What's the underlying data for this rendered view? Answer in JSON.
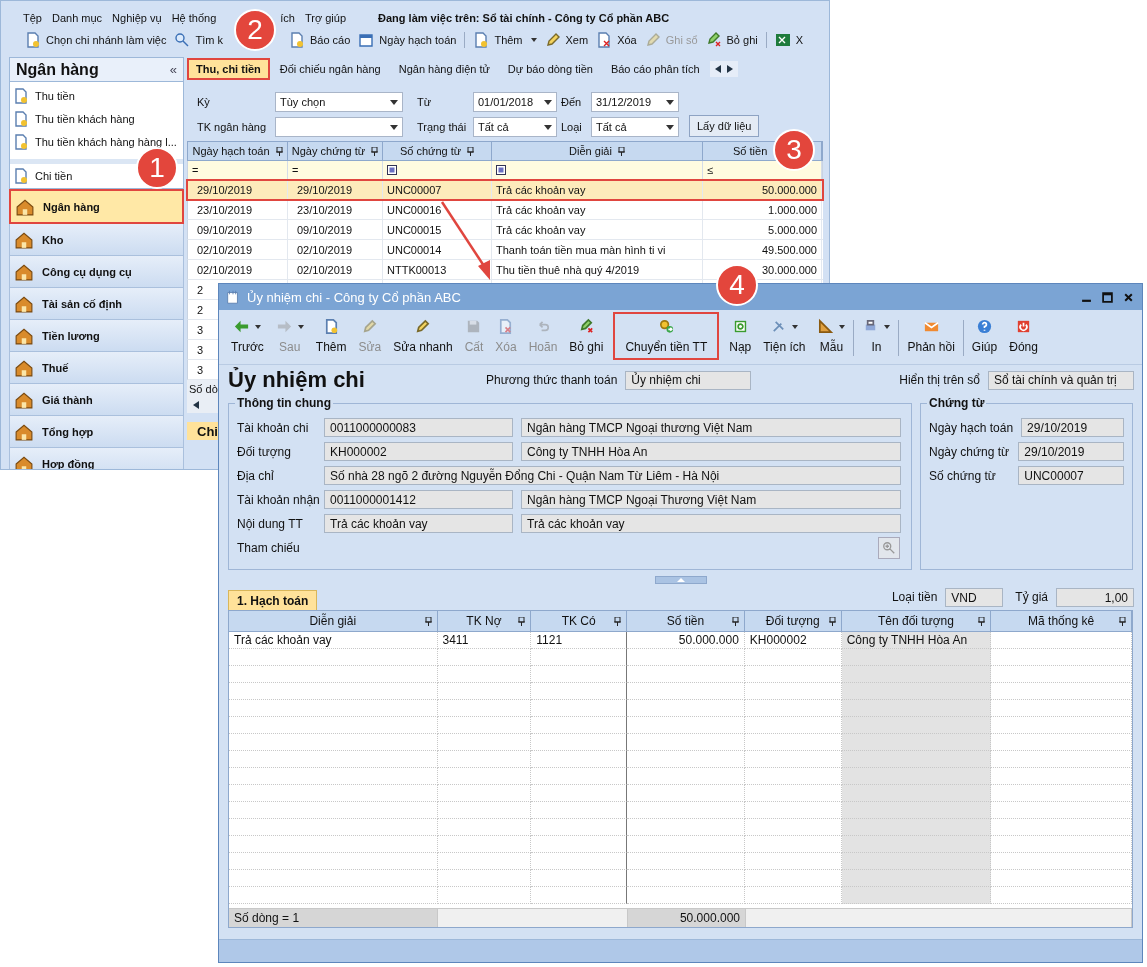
{
  "main_window": {
    "menu": [
      "Tệp",
      "Danh mục",
      "Nghiệp vụ",
      "Hệ thống",
      "ích",
      "Trợ giúp"
    ],
    "working_on": "Đang làm việc trên: Sổ tài chính - Công ty Cổ phần ABC",
    "toolbar": [
      [
        {
          "label": "Chọn chi nhánh làm việc",
          "disabled": false,
          "dropdown": false
        },
        {
          "label": "Tìm k",
          "disabled": false,
          "dropdown": false
        },
        {
          "label": "Báo cáo",
          "disabled": false,
          "dropdown": false
        },
        {
          "label": "Ngày hạch toán",
          "disabled": false,
          "dropdown": false
        }
      ],
      [
        {
          "label": "Thêm",
          "disabled": false,
          "dropdown": true
        },
        {
          "label": "Xem",
          "disabled": false,
          "dropdown": false
        },
        {
          "label": "Xóa",
          "disabled": false,
          "dropdown": false
        },
        {
          "label": "Ghi sổ",
          "disabled": true,
          "dropdown": false
        },
        {
          "label": "Bỏ ghi",
          "disabled": false,
          "dropdown": false
        }
      ],
      [
        {
          "label": "X",
          "disabled": false,
          "dropdown": false
        }
      ]
    ],
    "sidebar": {
      "title": "Ngân hàng",
      "collapse_glyph": "«",
      "items": [
        "Thu tiền",
        "Thu tiền khách hàng",
        "Thu tiền khách hàng hàng l...",
        "Chi tiền"
      ],
      "modules": [
        {
          "label": "Ngân hàng",
          "selected": true,
          "highlighted": true
        },
        {
          "label": "Kho",
          "selected": false,
          "highlighted": false
        },
        {
          "label": "Công cụ dụng cụ",
          "selected": false,
          "highlighted": false
        },
        {
          "label": "Tài sản cố định",
          "selected": false,
          "highlighted": false
        },
        {
          "label": "Tiền lương",
          "selected": false,
          "highlighted": false
        },
        {
          "label": "Thuế",
          "selected": false,
          "highlighted": false
        },
        {
          "label": "Giá thành",
          "selected": false,
          "highlighted": false
        },
        {
          "label": "Tổng hợp",
          "selected": false,
          "highlighted": false
        },
        {
          "label": "Hợp đồng",
          "selected": false,
          "highlighted": false
        }
      ]
    },
    "tabs": [
      {
        "label": "Thu, chi tiền",
        "selected": true,
        "highlighted": true
      },
      {
        "label": "Đối chiếu ngân hàng",
        "selected": false,
        "highlighted": false
      },
      {
        "label": "Ngân hàng điện tử",
        "selected": false,
        "highlighted": false
      },
      {
        "label": "Dự báo dòng tiền",
        "selected": false,
        "highlighted": false
      },
      {
        "label": "Báo cáo phân tích",
        "selected": false,
        "highlighted": false
      }
    ],
    "filters": [
      {
        "label": "Kỳ",
        "value": "Tùy chọn"
      },
      {
        "label": "Từ",
        "value": "01/01/2018"
      },
      {
        "label": "Đến",
        "value": "31/12/2019"
      },
      {
        "label": "TK ngân hàng"
      },
      {
        "label": "Trạng thái",
        "value": "Tất cả"
      },
      {
        "label": "Loại",
        "value": "Tất cả"
      }
    ],
    "fetch_button": "Lấy dữ liệu",
    "table": {
      "columns": [
        {
          "label": "Ngày hạch toán",
          "kind": "text"
        },
        {
          "label": "Ngày chứng từ",
          "kind": "text"
        },
        {
          "label": "Số chứng từ",
          "kind": "text"
        },
        {
          "label": "Diễn giải",
          "kind": "text"
        },
        {
          "label": "Số tiền",
          "kind": "amount"
        }
      ],
      "filter_row": [
        {
          "kind": "op",
          "text": "="
        },
        {
          "kind": "op",
          "text": "="
        },
        {
          "kind": "box"
        },
        {
          "kind": "box"
        },
        {
          "kind": "op",
          "text": "≤"
        }
      ],
      "rows": [
        {
          "cells": [
            "29/10/2019",
            "29/10/2019",
            "UNC00007",
            "Trả các khoản vay",
            "50.000.000"
          ],
          "selected": true,
          "highlighted": true
        },
        {
          "cells": [
            "23/10/2019",
            "23/10/2019",
            "UNC00016",
            "Trả các khoản vay",
            "1.000.000"
          ],
          "selected": false,
          "highlighted": false
        },
        {
          "cells": [
            "09/10/2019",
            "09/10/2019",
            "UNC00015",
            "Trả các khoản vay",
            "5.000.000"
          ],
          "selected": false,
          "highlighted": false
        },
        {
          "cells": [
            "02/10/2019",
            "02/10/2019",
            "UNC00014",
            "Thanh toán tiền mua màn hình ti vi",
            "49.500.000"
          ],
          "selected": false,
          "highlighted": false
        },
        {
          "cells": [
            "02/10/2019",
            "02/10/2019",
            "NTTK00013",
            "Thu tiền thuê nhà quý 4/2019",
            "30.000.000"
          ],
          "selected": false,
          "highlighted": false
        },
        {
          "cells": [
            "2"
          ],
          "selected": false,
          "highlighted": false
        },
        {
          "cells": [
            "2"
          ],
          "selected": false,
          "highlighted": false
        },
        {
          "cells": [
            "3"
          ],
          "selected": false,
          "highlighted": false
        },
        {
          "cells": [
            "3"
          ],
          "selected": false,
          "highlighted": false
        },
        {
          "cells": [
            "3"
          ],
          "selected": false,
          "highlighted": false
        }
      ],
      "footer": "Số dò"
    },
    "bottom_tab": "Chi"
  },
  "dialog": {
    "title": "Ủy nhiệm chi - Công ty Cổ phần ABC",
    "toolbar": [
      [
        {
          "label": "Trước",
          "disabled": false,
          "dropdown": true,
          "highlighted": false
        },
        {
          "label": "Sau",
          "disabled": true,
          "dropdown": true,
          "highlighted": false
        },
        {
          "label": "Thêm",
          "disabled": false,
          "dropdown": false,
          "highlighted": false
        },
        {
          "label": "Sửa",
          "disabled": true,
          "dropdown": false,
          "highlighted": false
        },
        {
          "label": "Sửa nhanh",
          "disabled": false,
          "dropdown": false,
          "highlighted": false
        },
        {
          "label": "Cất",
          "disabled": true,
          "dropdown": false,
          "highlighted": false
        },
        {
          "label": "Xóa",
          "disabled": true,
          "dropdown": false,
          "highlighted": false
        },
        {
          "label": "Hoãn",
          "disabled": true,
          "dropdown": false,
          "highlighted": false
        },
        {
          "label": "Bỏ ghi",
          "disabled": false,
          "dropdown": false,
          "highlighted": false
        }
      ],
      [
        {
          "label": "Chuyển tiền TT",
          "disabled": false,
          "dropdown": false,
          "highlighted": true
        }
      ],
      [
        {
          "label": "Nạp",
          "disabled": false,
          "dropdown": false,
          "highlighted": false
        },
        {
          "label": "Tiện ích",
          "disabled": false,
          "dropdown": true,
          "highlighted": false
        },
        {
          "label": "Mẫu",
          "disabled": false,
          "dropdown": true,
          "highlighted": false
        }
      ],
      [
        {
          "label": "In",
          "disabled": false,
          "dropdown": true,
          "highlighted": false
        }
      ],
      [
        {
          "label": "Phản hồi",
          "disabled": false,
          "dropdown": false,
          "highlighted": false
        }
      ],
      [
        {
          "label": "Giúp",
          "disabled": false,
          "dropdown": false,
          "highlighted": false
        },
        {
          "label": "Đóng",
          "disabled": false,
          "dropdown": false,
          "highlighted": false
        }
      ]
    ],
    "heading": "Ủy nhiệm chi",
    "payment_method": {
      "label": "Phương thức thanh toán",
      "value": "Ủy nhiệm chi"
    },
    "book": {
      "label": "Hiển thị trên sổ",
      "value": "Sổ tài chính và quản trị"
    },
    "general": {
      "title": "Thông tin chung",
      "rows": [
        {
          "label": "Tài khoản chi",
          "values": [
            "0011000000083",
            "Ngân hàng TMCP Ngoại thương Việt Nam"
          ]
        },
        {
          "label": "Đối tượng",
          "values": [
            "KH000002",
            "Công ty TNHH Hòa An"
          ]
        },
        {
          "label": "Địa chỉ",
          "values": [
            "Số nhà 28 ngõ 2 đường Nguyễn Đổng Chi - Quận Nam Từ Liêm - Hà Nội"
          ]
        },
        {
          "label": "Tài khoản nhận",
          "values": [
            "0011000001412",
            "Ngân hàng TMCP Ngoại Thương Việt Nam"
          ]
        },
        {
          "label": "Nội dung TT",
          "values": [
            "Trả các khoản vay",
            "Trả các khoản vay"
          ]
        }
      ],
      "reference_label": "Tham chiếu"
    },
    "voucher": {
      "title": "Chứng từ",
      "rows": [
        {
          "label": "Ngày hạch toán",
          "value": "29/10/2019"
        },
        {
          "label": "Ngày chứng từ",
          "value": "29/10/2019"
        },
        {
          "label": "Số chứng từ",
          "value": "UNC00007"
        }
      ]
    },
    "detail_tab": {
      "label": "1. Hạch toán",
      "selected": true
    },
    "currency": {
      "label": "Loại tiền",
      "value": "VND"
    },
    "rate": {
      "label": "Tỷ giá",
      "value": "1,00"
    },
    "grid": {
      "columns": [
        {
          "label": "Diễn giải",
          "kind": "text",
          "readonly": false
        },
        {
          "label": "TK Nợ",
          "kind": "text",
          "readonly": false
        },
        {
          "label": "TK Có",
          "kind": "text",
          "readonly": false
        },
        {
          "label": "Số tiền",
          "kind": "amount",
          "readonly": false
        },
        {
          "label": "Đối tượng",
          "kind": "text",
          "readonly": false
        },
        {
          "label": "Tên đối tượng",
          "kind": "text",
          "readonly": true
        },
        {
          "label": "Mã thống kê",
          "kind": "text",
          "readonly": false
        }
      ],
      "rows": [
        {
          "cells": [
            "Trả các khoản vay",
            "3411",
            "1121",
            "50.000.000",
            "KH000002",
            "Công ty TNHH Hòa An"
          ]
        }
      ],
      "footer": {
        "row_count": "Số dòng = 1",
        "total": "50.000.000"
      }
    }
  },
  "callouts": [
    "1",
    "2",
    "3",
    "4"
  ]
}
